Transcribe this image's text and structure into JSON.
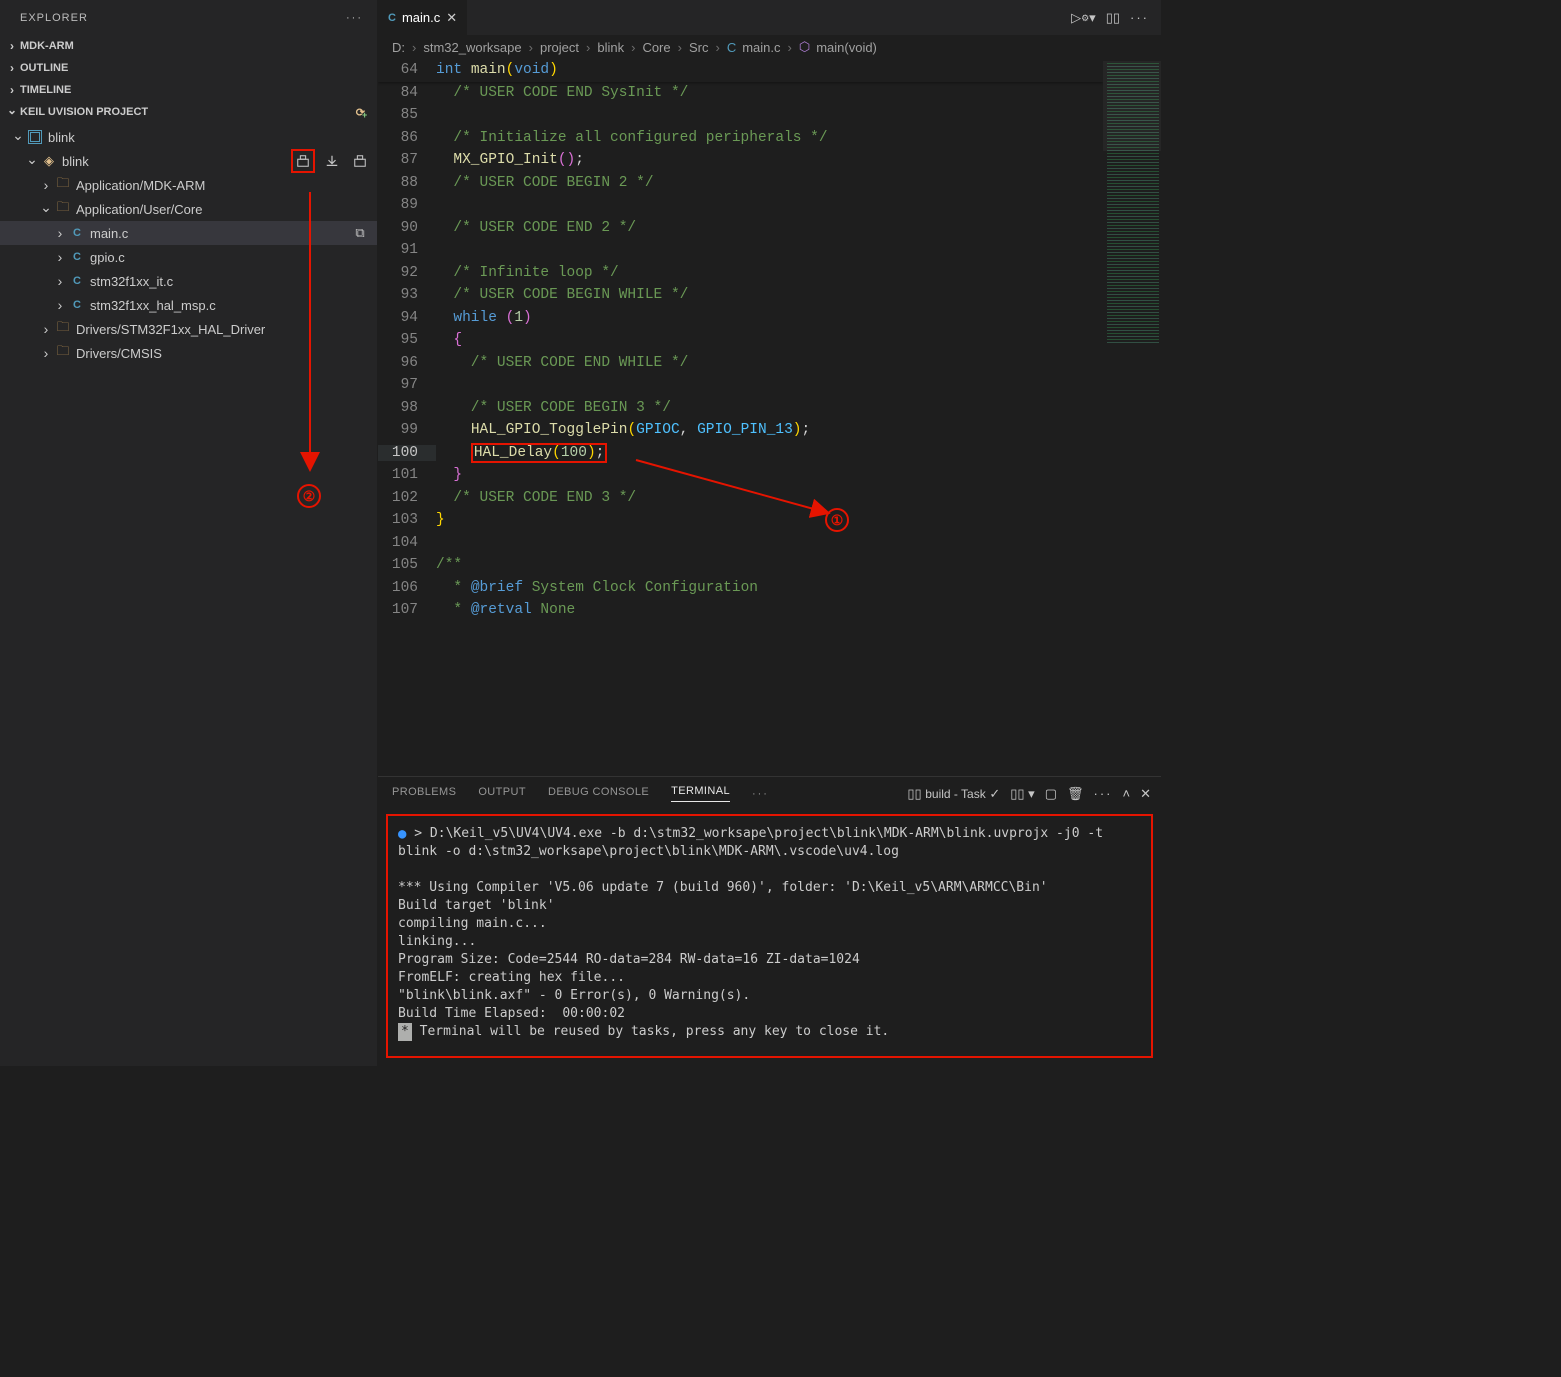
{
  "explorer": {
    "title": "EXPLORER",
    "sections": [
      "MDK-ARM",
      "OUTLINE",
      "TIMELINE"
    ],
    "keil_section": "KEIL UVISION PROJECT",
    "project": "blink",
    "target": "blink",
    "groups": {
      "mdkarm": "Application/MDK-ARM",
      "usercore": "Application/User/Core",
      "hal": "Drivers/STM32F1xx_HAL_Driver",
      "cmsis": "Drivers/CMSIS"
    },
    "files": {
      "main": "main.c",
      "gpio": "gpio.c",
      "it": "stm32f1xx_it.c",
      "msp": "stm32f1xx_hal_msp.c"
    }
  },
  "tab": {
    "filename": "main.c"
  },
  "breadcrumb": {
    "d": "D:",
    "ws": "stm32_worksape",
    "proj": "project",
    "blink": "blink",
    "core": "Core",
    "src": "Src",
    "file": "main.c",
    "symbol": "main(void)"
  },
  "code": {
    "decl": "int main(void)",
    "lines": {
      "84": "  /* USER CODE END SysInit */",
      "85": "",
      "86": "  /* Initialize all configured peripherals */",
      "87_fn": "MX_GPIO_Init",
      "88": "  /* USER CODE BEGIN 2 */",
      "89": "",
      "90": "  /* USER CODE END 2 */",
      "91": "",
      "92": "  /* Infinite loop */",
      "93": "  /* USER CODE BEGIN WHILE */",
      "94_kw": "while",
      "94_num": "1",
      "96": "    /* USER CODE END WHILE */",
      "97": "",
      "98": "    /* USER CODE BEGIN 3 */",
      "99_fn": "HAL_GPIO_TogglePin",
      "99_a": "GPIOC",
      "99_b": "GPIO_PIN_13",
      "100_fn": "HAL_Delay",
      "100_arg": "100",
      "102": "  /* USER CODE END 3 */",
      "105": "/**",
      "106_tag": "@brief",
      "106_txt": " System Clock Configuration",
      "107_tag": "@retval",
      "107_txt": " None"
    }
  },
  "panel": {
    "tabs": {
      "problems": "PROBLEMS",
      "output": "OUTPUT",
      "debug": "DEBUG CONSOLE",
      "terminal": "TERMINAL"
    },
    "task_label": "build - Task",
    "terminal": {
      "cmd": "D:\\Keil_v5\\UV4\\UV4.exe -b d:\\stm32_worksape\\project\\blink\\MDK-ARM\\blink.uvprojx -j0 -t blink -o d:\\stm32_worksape\\project\\blink\\MDK-ARM\\.vscode\\uv4.log",
      "l1": "*** Using Compiler 'V5.06 update 7 (build 960)', folder: 'D:\\Keil_v5\\ARM\\ARMCC\\Bin'",
      "l2": "Build target 'blink'",
      "l3": "compiling main.c...",
      "l4": "linking...",
      "l5": "Program Size: Code=2544 RO-data=284 RW-data=16 ZI-data=1024",
      "l6": "FromELF: creating hex file...",
      "l7": "\"blink\\blink.axf\" - 0 Error(s), 0 Warning(s).",
      "l8": "Build Time Elapsed:  00:00:02",
      "l9": " Terminal will be reused by tasks, press any key to close it."
    }
  },
  "annotations": {
    "n1": "①",
    "n2": "②"
  }
}
